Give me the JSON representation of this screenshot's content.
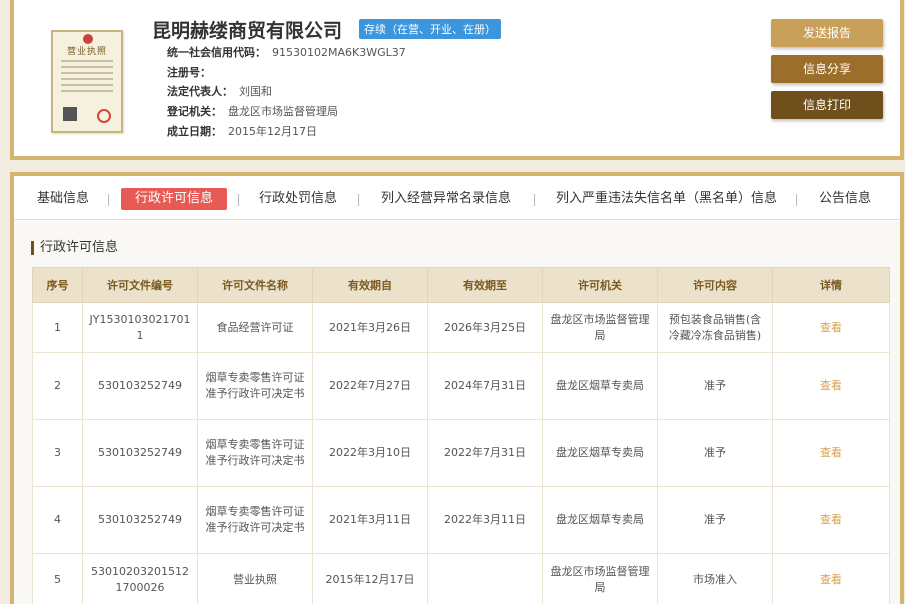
{
  "company": {
    "name": "昆明赫缕商贸有限公司",
    "status": "存续（在营、开业、在册）",
    "license_image_title": "营业执照",
    "fields": [
      {
        "label": "统一社会信用代码：",
        "value": "91530102MA6K3WGL37"
      },
      {
        "label": "注册号：",
        "value": ""
      },
      {
        "label": "法定代表人：",
        "value": "刘国和"
      },
      {
        "label": "登记机关：",
        "value": "盘龙区市场监督管理局"
      },
      {
        "label": "成立日期：",
        "value": "2015年12月17日"
      }
    ]
  },
  "buttons": {
    "report": "发送报告",
    "share": "信息分享",
    "print": "信息打印"
  },
  "tabs": [
    {
      "label": "基础信息",
      "active": false
    },
    {
      "label": "行政许可信息",
      "active": true
    },
    {
      "label": "行政处罚信息",
      "active": false
    },
    {
      "label": "列入经营异常名录信息",
      "active": false
    },
    {
      "label": "列入严重违法失信名单（黑名单）信息",
      "active": false
    },
    {
      "label": "公告信息",
      "active": false
    }
  ],
  "section": {
    "title": "行政许可信息"
  },
  "table": {
    "headers": [
      "序号",
      "许可文件编号",
      "许可文件名称",
      "有效期自",
      "有效期至",
      "许可机关",
      "许可内容",
      "详情"
    ],
    "rows": [
      [
        "1",
        "JY15301030217011",
        "食品经营许可证",
        "2021年3月26日",
        "2026年3月25日",
        "盘龙区市场监督管理局",
        "预包装食品销售(含冷藏冷冻食品销售)",
        "查看"
      ],
      [
        "2",
        "530103252749",
        "烟草专卖零售许可证准予行政许可决定书",
        "2022年7月27日",
        "2024年7月31日",
        "盘龙区烟草专卖局",
        "准予",
        "查看"
      ],
      [
        "3",
        "530103252749",
        "烟草专卖零售许可证准予行政许可决定书",
        "2022年3月10日",
        "2022年7月31日",
        "盘龙区烟草专卖局",
        "准予",
        "查看"
      ],
      [
        "4",
        "530103252749",
        "烟草专卖零售许可证准予行政许可决定书",
        "2021年3月11日",
        "2022年3月11日",
        "盘龙区烟草专卖局",
        "准予",
        "查看"
      ],
      [
        "5",
        "530102032015121700026",
        "营业执照",
        "2015年12月17日",
        "",
        "盘龙区市场监督管理局",
        "市场准入",
        "查看"
      ]
    ]
  }
}
